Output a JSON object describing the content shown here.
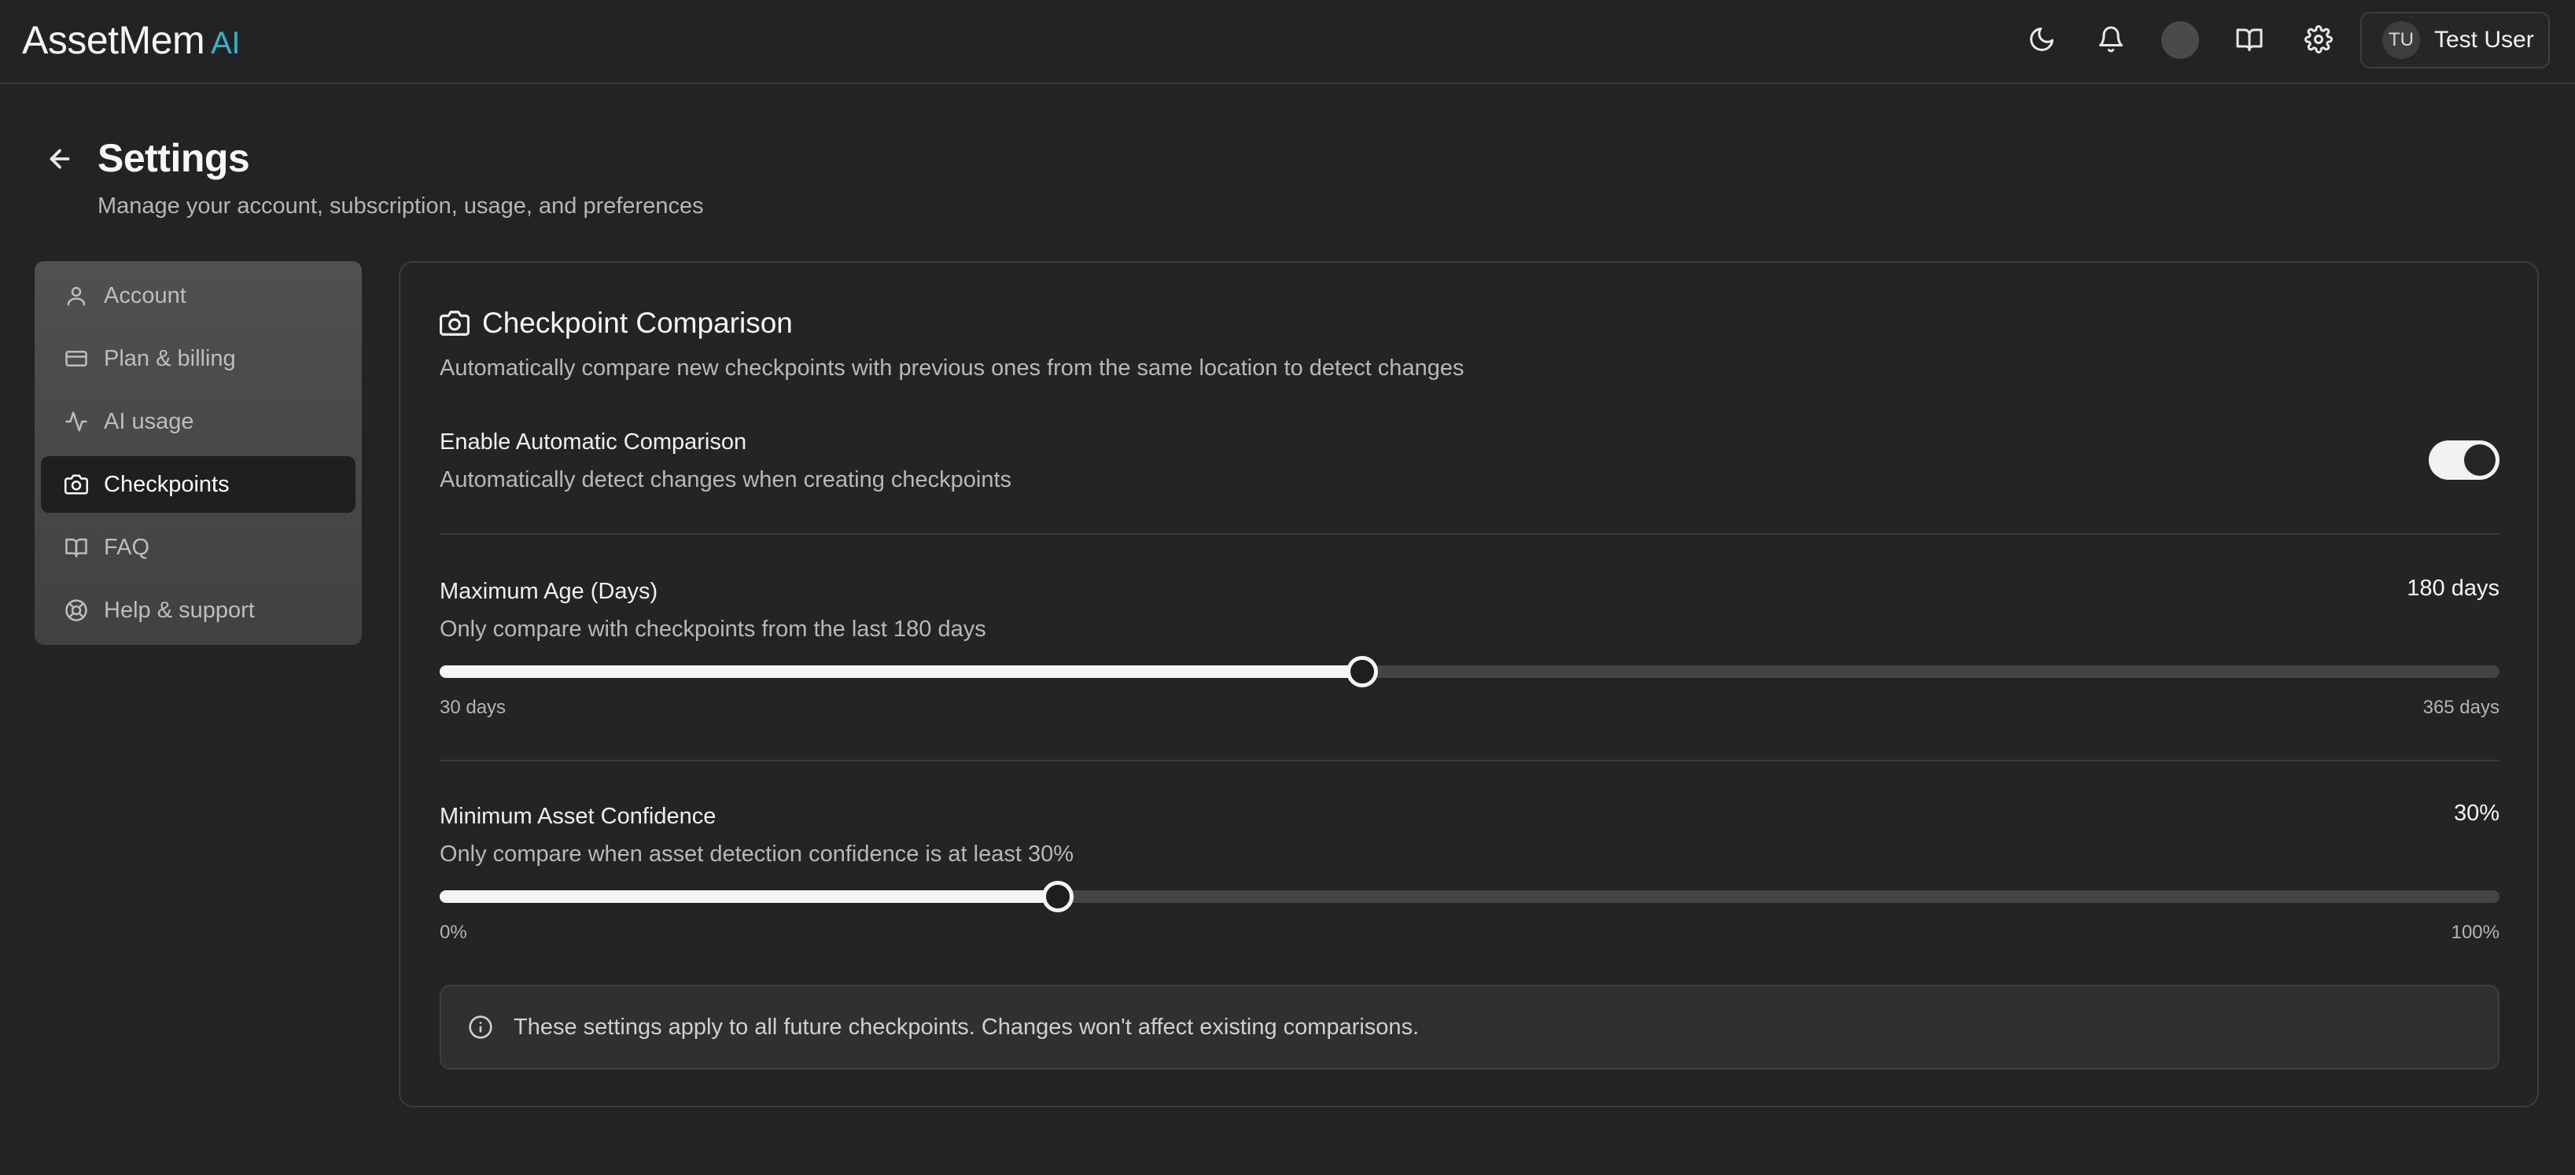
{
  "app": {
    "brand": "AssetMem",
    "brand_suffix": "AI"
  },
  "header": {
    "icons": [
      "moon-icon",
      "bell-icon",
      "status-dot",
      "book-open-icon",
      "gear-icon"
    ],
    "user": {
      "initials": "TU",
      "name": "Test User"
    }
  },
  "page": {
    "title": "Settings",
    "subtitle": "Manage your account, subscription, usage, and preferences"
  },
  "sidebar": {
    "items": [
      {
        "label": "Account",
        "icon": "user-icon",
        "active": false
      },
      {
        "label": "Plan & billing",
        "icon": "credit-card-icon",
        "active": false
      },
      {
        "label": "AI usage",
        "icon": "activity-icon",
        "active": false
      },
      {
        "label": "Checkpoints",
        "icon": "camera-icon",
        "active": true
      },
      {
        "label": "FAQ",
        "icon": "book-open-icon",
        "active": false
      },
      {
        "label": "Help & support",
        "icon": "life-buoy-icon",
        "active": false
      }
    ]
  },
  "checkpoint": {
    "title": "Checkpoint Comparison",
    "description": "Automatically compare new checkpoints with previous ones from the same location to detect changes",
    "auto": {
      "label": "Enable Automatic Comparison",
      "sub": "Automatically detect changes when creating checkpoints",
      "enabled": true
    },
    "max_age": {
      "label": "Maximum Age (Days)",
      "sub": "Only compare with checkpoints from the last 180 days",
      "value_text": "180 days",
      "value": 180,
      "min": 30,
      "max": 365,
      "min_label": "30 days",
      "max_label": "365 days"
    },
    "confidence": {
      "label": "Minimum Asset Confidence",
      "sub": "Only compare when asset detection confidence is at least 30%",
      "value_text": "30%",
      "value": 30,
      "min": 0,
      "max": 100,
      "min_label": "0%",
      "max_label": "100%"
    },
    "note": "These settings apply to all future checkpoints. Changes won't affect existing comparisons."
  },
  "colors": {
    "background": "#232323",
    "accent": "#2bb6d0",
    "sidebar_active": "#1f1f1f",
    "slider_fill": "#f5f5f5"
  }
}
